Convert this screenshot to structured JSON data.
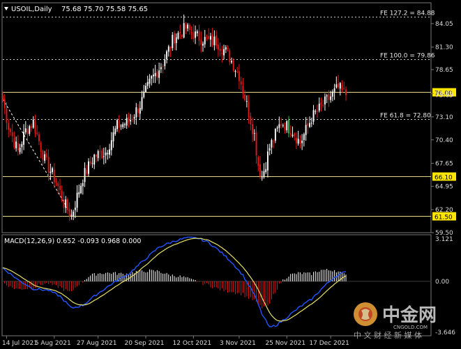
{
  "header": {
    "symbol": "USOIL,Daily",
    "ohlc": "75.68 75.70 75.58 75.65"
  },
  "chart_data": [
    {
      "type": "candlestick",
      "title": "USOIL,Daily",
      "ylim": [
        59.5,
        86.5
      ],
      "y_ticks": [
        "84.05",
        "81.30",
        "78.65",
        "75.85",
        "73.10",
        "70.40",
        "67.65",
        "64.95",
        "62.20",
        "59.50"
      ],
      "x_ticks": [
        "14 Jul 2021",
        "5 Aug 2021",
        "27 Aug 2021",
        "20 Sep 2021",
        "12 Oct 2021",
        "3 Nov 2021",
        "25 Nov 2021",
        "17 Dec 2021"
      ],
      "levels": [
        {
          "label": "FE 127.2 = 84.88",
          "value": 84.88,
          "style": "dotted"
        },
        {
          "label": "FE 100.0 = 79.86",
          "value": 79.86,
          "style": "dotted"
        },
        {
          "label": "76.00",
          "value": 76.0,
          "style": "solid"
        },
        {
          "label": "FE 61.8 = 72.80",
          "value": 72.8,
          "style": "dotted"
        },
        {
          "label": "66.10",
          "value": 66.1,
          "style": "solid"
        },
        {
          "label": "61.50",
          "value": 61.5,
          "style": "solid"
        }
      ],
      "current_price": "75.65",
      "anchors": [
        [
          0,
          75
        ],
        [
          3,
          72
        ],
        [
          8,
          69
        ],
        [
          12,
          71.5
        ],
        [
          16,
          72.5
        ],
        [
          22,
          68
        ],
        [
          28,
          65.5
        ],
        [
          32,
          63
        ],
        [
          36,
          61.5
        ],
        [
          42,
          66
        ],
        [
          48,
          68.5
        ],
        [
          54,
          69
        ],
        [
          60,
          72
        ],
        [
          66,
          72.5
        ],
        [
          72,
          74.5
        ],
        [
          78,
          77.5
        ],
        [
          84,
          79.5
        ],
        [
          90,
          82.5
        ],
        [
          96,
          83.5
        ],
        [
          102,
          82.5
        ],
        [
          108,
          82
        ],
        [
          112,
          82
        ],
        [
          118,
          80.5
        ],
        [
          124,
          78
        ],
        [
          128,
          74.5
        ],
        [
          132,
          71
        ],
        [
          134,
          67.5
        ],
        [
          136,
          66
        ],
        [
          140,
          69.5
        ],
        [
          146,
          72.5
        ],
        [
          152,
          71.5
        ],
        [
          156,
          70
        ],
        [
          162,
          73
        ],
        [
          166,
          74
        ],
        [
          172,
          75.5
        ],
        [
          176,
          76.5
        ],
        [
          180,
          75.65
        ]
      ]
    },
    {
      "type": "macd",
      "label": "MACD(12,26,9) 0.652 -0.093 0.968 0.000",
      "ylim": [
        -3.646,
        3.121
      ],
      "y_ticks": [
        "3.121",
        "0.00",
        "-3.646"
      ],
      "macd_anchors": [
        [
          0,
          0.9
        ],
        [
          8,
          0.1
        ],
        [
          16,
          -0.5
        ],
        [
          24,
          -0.6
        ],
        [
          30,
          -1.0
        ],
        [
          36,
          -1.8
        ],
        [
          42,
          -1.6
        ],
        [
          50,
          -0.8
        ],
        [
          58,
          -0.1
        ],
        [
          66,
          0.5
        ],
        [
          74,
          1.4
        ],
        [
          82,
          2.3
        ],
        [
          90,
          2.7
        ],
        [
          96,
          2.9
        ],
        [
          102,
          2.9
        ],
        [
          108,
          2.6
        ],
        [
          114,
          2.0
        ],
        [
          120,
          1.3
        ],
        [
          126,
          0.4
        ],
        [
          132,
          -0.9
        ],
        [
          136,
          -2.2
        ],
        [
          140,
          -3.1
        ],
        [
          144,
          -2.9
        ],
        [
          150,
          -2.3
        ],
        [
          156,
          -1.7
        ],
        [
          162,
          -1.2
        ],
        [
          168,
          -0.4
        ],
        [
          174,
          0.3
        ],
        [
          180,
          0.652
        ]
      ]
    }
  ],
  "watermark": {
    "brand": "中金网",
    "domain": "CNGOLD.COM",
    "tagline": "中 文 财 经 新 媒 体"
  }
}
